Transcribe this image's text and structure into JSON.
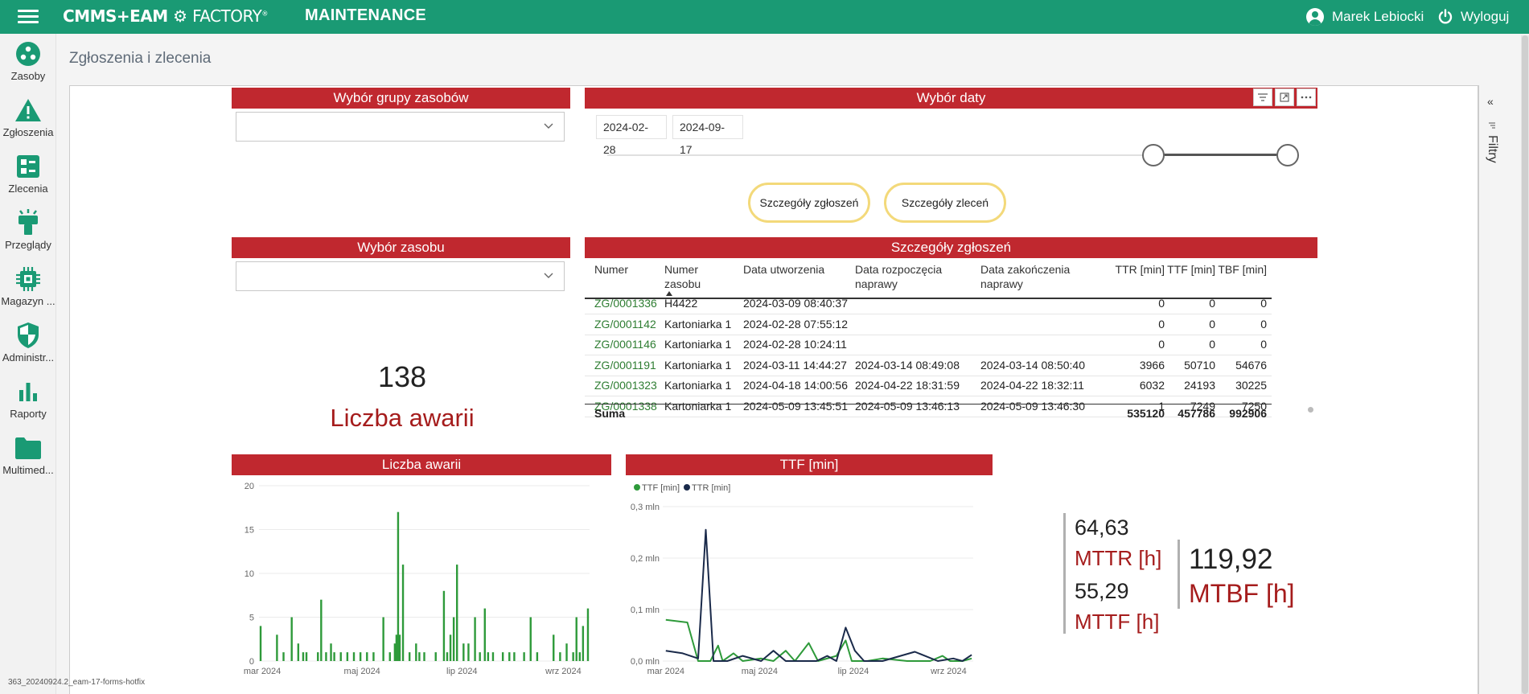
{
  "app": {
    "logo": "CMMS+EAM",
    "logo_sub": "FACTORY",
    "module": "MAINTENANCE",
    "user_name": "Marek Lebiocki",
    "logout_label": "Wyloguj",
    "brand_color": "#1a9a74",
    "version": "363_20240924.2_eam-17-forms-hotfix"
  },
  "sidebar": [
    {
      "label": "Zasoby",
      "icon": "assets-icon"
    },
    {
      "label": "Zgłoszenia",
      "icon": "warning-icon"
    },
    {
      "label": "Zlecenia",
      "icon": "orders-icon"
    },
    {
      "label": "Przeglądy",
      "icon": "inspection-icon"
    },
    {
      "label": "Magazyn ...",
      "icon": "chip-icon"
    },
    {
      "label": "Administr...",
      "icon": "shield-icon"
    },
    {
      "label": "Raporty",
      "icon": "bar-chart-icon"
    },
    {
      "label": "Multimed...",
      "icon": "folder-icon"
    }
  ],
  "page": {
    "title": "Zgłoszenia i zlecenia"
  },
  "report": {
    "accent_color": "#c0282f",
    "asset_group_header": "Wybór grupy zasobów",
    "asset_group_value": "",
    "date_header": "Wybór daty",
    "date_from": "2024-02-28",
    "date_to": "2024-09-17",
    "slider_from_fraction": 0.79,
    "slider_to_fraction": 1.0,
    "btn_requests": "Szczegóły zgłoszeń",
    "btn_orders": "Szczegóły zleceń",
    "asset_header": "Wybór zasobu",
    "asset_value": "",
    "failures_count": "138",
    "failures_label": "Liczba awarii",
    "filters_label": "Filtry",
    "details": {
      "header": "Szczegóły zgłoszeń",
      "columns": [
        "Numer",
        "Numer zasobu",
        "Data utworzenia",
        "Data rozpoczęcia naprawy",
        "Data zakończenia naprawy",
        "TTR [min]",
        "TTF [min]",
        "TBF [min]"
      ],
      "rows": [
        [
          "ZG/0001336",
          "H4422",
          "2024-03-09 08:40:37",
          "",
          "",
          "0",
          "0",
          "0"
        ],
        [
          "ZG/0001142",
          "Kartoniarka 1",
          "2024-02-28 07:55:12",
          "",
          "",
          "0",
          "0",
          "0"
        ],
        [
          "ZG/0001146",
          "Kartoniarka 1",
          "2024-02-28 10:24:11",
          "",
          "",
          "0",
          "0",
          "0"
        ],
        [
          "ZG/0001191",
          "Kartoniarka 1",
          "2024-03-11 14:44:27",
          "2024-03-14 08:49:08",
          "2024-03-14 08:50:40",
          "3966",
          "50710",
          "54676"
        ],
        [
          "ZG/0001323",
          "Kartoniarka 1",
          "2024-04-18 14:00:56",
          "2024-04-22 18:31:59",
          "2024-04-22 18:32:11",
          "6032",
          "24193",
          "30225"
        ],
        [
          "ZG/0001338",
          "Kartoniarka 1",
          "2024-05-09 13:45:51",
          "2024-05-09 13:46:13",
          "2024-05-09 13:46:30",
          "1",
          "7249",
          "7250"
        ]
      ],
      "sum_label": "Suma",
      "sum_ttr": "535120",
      "sum_ttf": "457786",
      "sum_tbf": "992906"
    },
    "chart1_header": "Liczba awarii",
    "chart2_header": "TTF [min]",
    "kpis": {
      "mttr_value": "64,63",
      "mttr_label": "MTTR [h]",
      "mttf_value": "55,29",
      "mttf_label": "MTTF [h]",
      "mtbf_value": "119,92",
      "mtbf_label": "MTBF [h]"
    }
  },
  "chart_data": [
    {
      "type": "bar",
      "title": "Liczba awarii",
      "ylim": [
        0,
        20
      ],
      "y_ticks": [
        "0",
        "5",
        "10",
        "15",
        "20"
      ],
      "x_ticks": [
        "mar 2024",
        "maj 2024",
        "lip 2024",
        "wrz 2024"
      ],
      "x_range": [
        "2024-02-28",
        "2024-09-17"
      ],
      "color": "#2e9a3a",
      "points": [
        [
          "2024-02-29",
          4
        ],
        [
          "2024-03-10",
          3
        ],
        [
          "2024-03-14",
          1
        ],
        [
          "2024-03-19",
          5
        ],
        [
          "2024-03-23",
          2
        ],
        [
          "2024-03-26",
          1
        ],
        [
          "2024-03-28",
          1
        ],
        [
          "2024-04-04",
          1
        ],
        [
          "2024-04-06",
          7
        ],
        [
          "2024-04-09",
          1
        ],
        [
          "2024-04-12",
          2
        ],
        [
          "2024-04-14",
          1
        ],
        [
          "2024-04-18",
          1
        ],
        [
          "2024-04-22",
          1
        ],
        [
          "2024-04-26",
          1
        ],
        [
          "2024-04-30",
          1
        ],
        [
          "2024-05-04",
          1
        ],
        [
          "2024-05-08",
          1
        ],
        [
          "2024-05-14",
          5
        ],
        [
          "2024-05-18",
          1
        ],
        [
          "2024-05-21",
          2
        ],
        [
          "2024-05-22",
          3
        ],
        [
          "2024-05-23",
          17
        ],
        [
          "2024-05-24",
          3
        ],
        [
          "2024-05-26",
          11
        ],
        [
          "2024-05-30",
          1
        ],
        [
          "2024-06-03",
          2
        ],
        [
          "2024-06-05",
          1
        ],
        [
          "2024-06-08",
          1
        ],
        [
          "2024-06-15",
          1
        ],
        [
          "2024-06-20",
          8
        ],
        [
          "2024-06-22",
          1
        ],
        [
          "2024-06-24",
          3
        ],
        [
          "2024-06-26",
          5
        ],
        [
          "2024-06-28",
          11
        ],
        [
          "2024-07-02",
          2
        ],
        [
          "2024-07-05",
          2
        ],
        [
          "2024-07-09",
          5
        ],
        [
          "2024-07-12",
          1
        ],
        [
          "2024-07-15",
          6
        ],
        [
          "2024-07-17",
          1
        ],
        [
          "2024-07-20",
          1
        ],
        [
          "2024-07-26",
          1
        ],
        [
          "2024-07-30",
          1
        ],
        [
          "2024-08-02",
          1
        ],
        [
          "2024-08-08",
          1
        ],
        [
          "2024-08-12",
          5
        ],
        [
          "2024-08-16",
          1
        ],
        [
          "2024-08-26",
          3
        ],
        [
          "2024-08-30",
          1
        ],
        [
          "2024-09-03",
          2
        ],
        [
          "2024-09-07",
          1
        ],
        [
          "2024-09-09",
          5
        ],
        [
          "2024-09-11",
          1
        ],
        [
          "2024-09-13",
          4
        ],
        [
          "2024-09-16",
          6
        ]
      ]
    },
    {
      "type": "line",
      "title": "TTF [min]",
      "ylim": [
        0,
        0.3
      ],
      "y_ticks": [
        "0,0 mln",
        "0,1 mln",
        "0,2 mln",
        "0,3 mln"
      ],
      "x_ticks": [
        "mar 2024",
        "maj 2024",
        "lip 2024",
        "wrz 2024"
      ],
      "x_range": [
        "2024-02-28",
        "2024-09-17"
      ],
      "legend": "top-left",
      "series": [
        {
          "name": "TTF [min]",
          "color": "#2e9a3a",
          "points": [
            [
              "2024-03-01",
              0.08
            ],
            [
              "2024-03-15",
              0.075
            ],
            [
              "2024-03-22",
              0.0
            ],
            [
              "2024-03-30",
              0.0
            ],
            [
              "2024-04-04",
              0.03
            ],
            [
              "2024-04-07",
              0.0
            ],
            [
              "2024-04-14",
              0.015
            ],
            [
              "2024-04-20",
              0.0
            ],
            [
              "2024-05-02",
              0.005
            ],
            [
              "2024-05-10",
              0.0
            ],
            [
              "2024-05-18",
              0.02
            ],
            [
              "2024-05-24",
              0.0
            ],
            [
              "2024-06-02",
              0.035
            ],
            [
              "2024-06-08",
              0.0
            ],
            [
              "2024-06-20",
              0.01
            ],
            [
              "2024-06-26",
              0.04
            ],
            [
              "2024-06-30",
              0.0
            ],
            [
              "2024-07-10",
              0.0
            ],
            [
              "2024-07-20",
              0.005
            ],
            [
              "2024-08-05",
              0.0
            ],
            [
              "2024-08-20",
              0.0
            ],
            [
              "2024-08-28",
              0.01
            ],
            [
              "2024-09-02",
              0.0
            ],
            [
              "2024-09-10",
              0.0
            ],
            [
              "2024-09-16",
              0.005
            ]
          ]
        },
        {
          "name": "TTR [min]",
          "color": "#1a2a4a",
          "points": [
            [
              "2024-03-01",
              0.02
            ],
            [
              "2024-03-12",
              0.015
            ],
            [
              "2024-03-22",
              0.005
            ],
            [
              "2024-03-27",
              0.255
            ],
            [
              "2024-04-01",
              0.0
            ],
            [
              "2024-04-10",
              0.0
            ],
            [
              "2024-04-20",
              0.01
            ],
            [
              "2024-05-02",
              0.0
            ],
            [
              "2024-05-10",
              0.02
            ],
            [
              "2024-05-18",
              0.0
            ],
            [
              "2024-05-28",
              0.0
            ],
            [
              "2024-06-07",
              0.0
            ],
            [
              "2024-06-14",
              0.01
            ],
            [
              "2024-06-20",
              0.0
            ],
            [
              "2024-06-26",
              0.065
            ],
            [
              "2024-07-02",
              0.02
            ],
            [
              "2024-07-08",
              0.0
            ],
            [
              "2024-07-20",
              0.0
            ],
            [
              "2024-08-10",
              0.018
            ],
            [
              "2024-08-25",
              0.0
            ],
            [
              "2024-09-04",
              0.005
            ],
            [
              "2024-09-10",
              0.0
            ],
            [
              "2024-09-16",
              0.012
            ]
          ]
        }
      ]
    }
  ]
}
